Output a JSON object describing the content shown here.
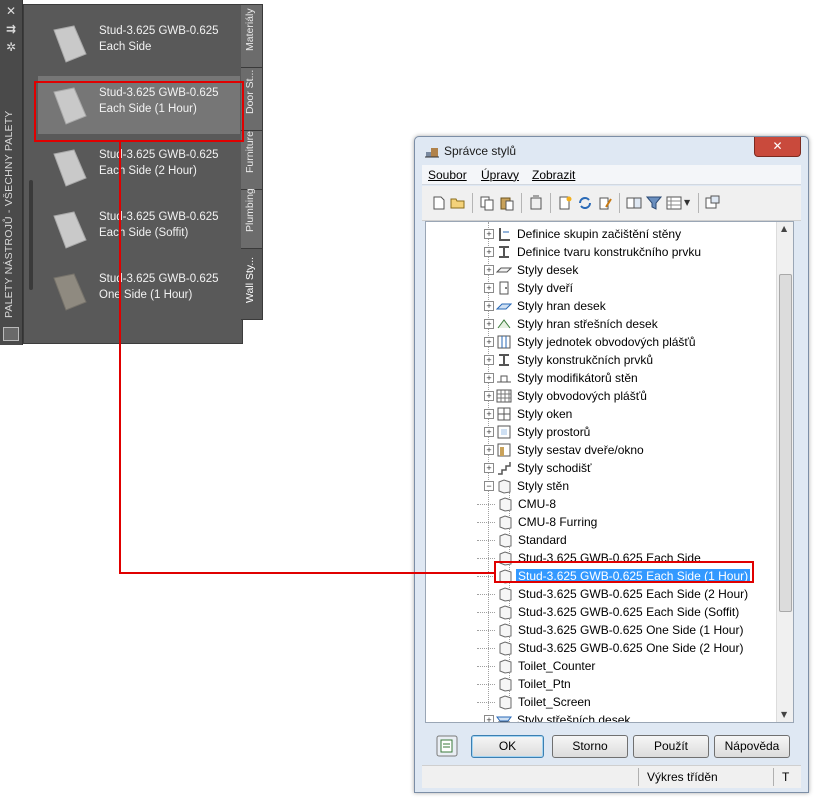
{
  "palette": {
    "vertical_title": "PALETY NÁSTROJŮ - VŠECHNY PALETY",
    "controls": [
      "close-icon",
      "pin-icon",
      "settings-icon"
    ],
    "items": [
      {
        "line1": "Stud-3.625 GWB-0.625",
        "line2": "Each Side",
        "swatch": "#c9c9c9"
      },
      {
        "line1": "Stud-3.625 GWB-0.625",
        "line2": "Each Side (1 Hour)",
        "swatch": "#c9c9c9"
      },
      {
        "line1": "Stud-3.625 GWB-0.625",
        "line2": "Each Side (2 Hour)",
        "swatch": "#c9c9c9"
      },
      {
        "line1": "Stud-3.625 GWB-0.625",
        "line2": "Each Side (Soffit)",
        "swatch": "#c9c9c9"
      },
      {
        "line1": "Stud-3.625 GWB-0.625",
        "line2": "One Side (1 Hour)",
        "swatch": "#8f8a80"
      }
    ],
    "tabs": [
      "Materiály",
      "Door St...",
      "Furniture",
      "Plumbing",
      "Wall Sty..."
    ],
    "active_tab": "Wall Sty..."
  },
  "dialog": {
    "title": "Správce stylů",
    "close": "✕",
    "menu": [
      "Soubor",
      "Úpravy",
      "Zobrazit"
    ],
    "tree": [
      {
        "label": "Definice skupin začištění stěny",
        "level": 1,
        "expander": "+",
        "icon": "cleanup-group-icon"
      },
      {
        "label": "Definice tvaru konstrukčního prvku",
        "level": 1,
        "expander": "+",
        "icon": "member-shape-icon"
      },
      {
        "label": "Styly desek",
        "level": 1,
        "expander": "+",
        "icon": "slab-icon"
      },
      {
        "label": "Styly dveří",
        "level": 1,
        "expander": "+",
        "icon": "door-icon"
      },
      {
        "label": "Styly hran desek",
        "level": 1,
        "expander": "+",
        "icon": "slab-edge-icon"
      },
      {
        "label": "Styly hran střešních desek",
        "level": 1,
        "expander": "+",
        "icon": "roof-slab-edge-icon"
      },
      {
        "label": "Styly jednotek obvodových plášťů",
        "level": 1,
        "expander": "+",
        "icon": "curtain-wall-unit-icon"
      },
      {
        "label": "Styly konstrukčních prvků",
        "level": 1,
        "expander": "+",
        "icon": "structural-member-icon"
      },
      {
        "label": "Styly modifikátorů stěn",
        "level": 1,
        "expander": "+",
        "icon": "wall-modifier-icon"
      },
      {
        "label": "Styly obvodových plášťů",
        "level": 1,
        "expander": "+",
        "icon": "curtain-wall-icon"
      },
      {
        "label": "Styly oken",
        "level": 1,
        "expander": "+",
        "icon": "window-icon"
      },
      {
        "label": "Styly prostorů",
        "level": 1,
        "expander": "+",
        "icon": "space-icon"
      },
      {
        "label": "Styly sestav dveře/okno",
        "level": 1,
        "expander": "+",
        "icon": "door-window-assembly-icon"
      },
      {
        "label": "Styly schodišť",
        "level": 1,
        "expander": "+",
        "icon": "stair-icon"
      },
      {
        "label": "Styly stěn",
        "level": 1,
        "expander": "−",
        "icon": "wall-style-icon"
      },
      {
        "label": "CMU-8",
        "level": 2,
        "icon": "wall-style-icon"
      },
      {
        "label": "CMU-8 Furring",
        "level": 2,
        "icon": "wall-style-icon"
      },
      {
        "label": "Standard",
        "level": 2,
        "icon": "wall-style-icon"
      },
      {
        "label": "Stud-3.625 GWB-0.625 Each Side",
        "level": 2,
        "icon": "wall-style-icon"
      },
      {
        "label": "Stud-3.625 GWB-0.625 Each Side (1 Hour)",
        "level": 2,
        "icon": "wall-style-icon",
        "selected": true
      },
      {
        "label": "Stud-3.625 GWB-0.625 Each Side (2 Hour)",
        "level": 2,
        "icon": "wall-style-icon"
      },
      {
        "label": "Stud-3.625 GWB-0.625 Each Side (Soffit)",
        "level": 2,
        "icon": "wall-style-icon"
      },
      {
        "label": "Stud-3.625 GWB-0.625 One Side (1 Hour)",
        "level": 2,
        "icon": "wall-style-icon"
      },
      {
        "label": "Stud-3.625 GWB-0.625 One Side (2 Hour)",
        "level": 2,
        "icon": "wall-style-icon"
      },
      {
        "label": "Toilet_Counter",
        "level": 2,
        "icon": "wall-style-icon"
      },
      {
        "label": "Toilet_Ptn",
        "level": 2,
        "icon": "wall-style-icon"
      },
      {
        "label": "Toilet_Screen",
        "level": 2,
        "icon": "wall-style-icon"
      },
      {
        "label": "Styly střešních desek",
        "level": 1,
        "expander": "+",
        "icon": "roof-slab-icon"
      }
    ],
    "buttons": {
      "ok": "OK",
      "cancel": "Storno",
      "apply": "Použít",
      "help": "Nápověda"
    },
    "status": {
      "text": "Výkres tříděn",
      "right": "T"
    }
  },
  "colors": {
    "selection": "#3399ff",
    "annotation": "#e00000"
  }
}
